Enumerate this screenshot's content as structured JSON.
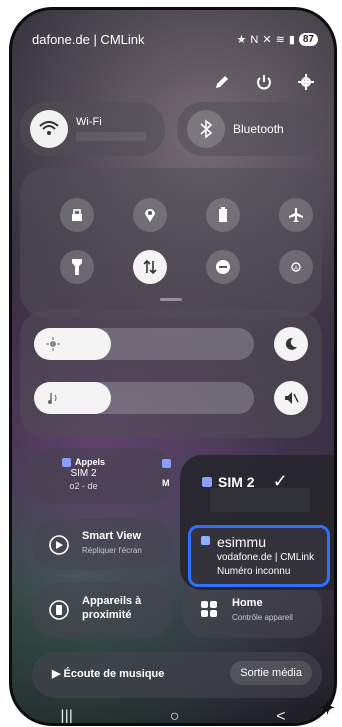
{
  "status_bar": {
    "carrier": "dafone.de | CMLink",
    "battery": "87"
  },
  "top_actions": [
    "pencil-icon",
    "power-icon",
    "gear-icon"
  ],
  "toggles": {
    "wifi": {
      "label": "Wi-Fi",
      "state": "on"
    },
    "bluetooth": {
      "label": "Bluetooth",
      "state": "off"
    }
  },
  "quick_tiles": [
    {
      "icon": "lock-icon",
      "state": "off"
    },
    {
      "icon": "location-icon",
      "state": "off"
    },
    {
      "icon": "battery-saver-icon",
      "state": "off"
    },
    {
      "icon": "airplane-icon",
      "state": "off"
    },
    {
      "icon": "flashlight-icon",
      "state": "off"
    },
    {
      "icon": "data-transfer-icon",
      "state": "on"
    },
    {
      "icon": "do-not-disturb-icon",
      "state": "off"
    },
    {
      "icon": "eye-comfort-icon",
      "state": "off"
    }
  ],
  "sliders": {
    "brightness_level": 0.35,
    "volume_level": 0.35
  },
  "calls": {
    "title": "Appels",
    "sim": "SIM 2",
    "operator": "o2 - de",
    "second_prefix": "M"
  },
  "smart_view": {
    "title": "Smart View",
    "subtitle": "Répliquer l'écran"
  },
  "nearby": {
    "title_line1": "Appareils à",
    "title_line2": "proximité"
  },
  "home": {
    "title": "Home",
    "subtitle": "Contrôle appareil"
  },
  "music": {
    "label": "Écoute de musique",
    "output": "Sortie média"
  },
  "sim_menu": {
    "selected": "SIM 2",
    "esim": {
      "name": "esimmu",
      "operator": "vodafone.de | CMLink",
      "number": "Numéro inconnu"
    }
  },
  "nav": {
    "recents": "|||",
    "home": "○",
    "back": "<"
  },
  "colors": {
    "accent": "#2f70ff",
    "sim_chip": "#8aa0ff"
  }
}
